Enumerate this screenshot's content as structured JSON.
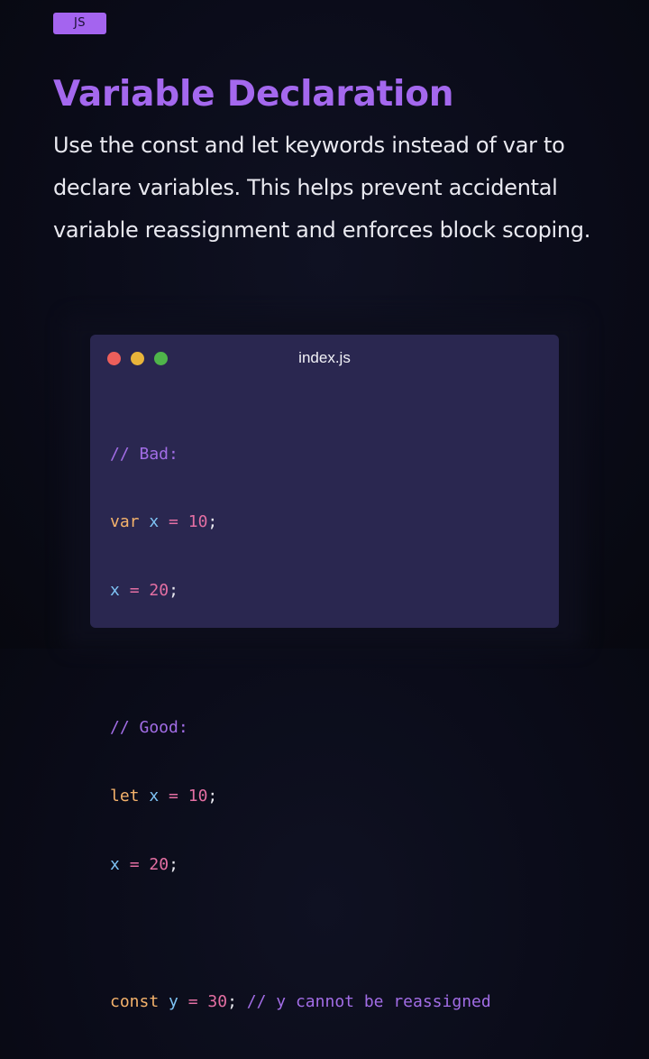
{
  "badge": "JS",
  "title": "Variable Declaration",
  "description": "Use the const and let keywords instead of var to declare variables. This helps prevent accidental variable reassignment and enforces block scoping.",
  "code_window": {
    "filename": "index.js",
    "window_buttons": [
      "red",
      "yellow",
      "green"
    ],
    "lines": {
      "l1": {
        "comment": "// Bad:"
      },
      "l2": {
        "keyword": "var",
        "ident": "x",
        "op": "=",
        "num": "10",
        "punct": ";"
      },
      "l3": {
        "ident": "x",
        "op": "=",
        "num": "20",
        "punct": ";"
      },
      "l5": {
        "comment": "// Good:"
      },
      "l6": {
        "keyword": "let",
        "ident": "x",
        "op": "=",
        "num": "10",
        "punct": ";"
      },
      "l7": {
        "ident": "x",
        "op": "=",
        "num": "20",
        "punct": ";"
      },
      "l9": {
        "keyword": "const",
        "ident": "y",
        "op": "=",
        "num": "30",
        "punct": ";",
        "comment": "// y cannot be reassigned"
      }
    }
  },
  "colors": {
    "accent": "#a468ee",
    "background": "#0a0b18",
    "code_bg": "#2a2750",
    "keyword": "#f4b26b",
    "identifier": "#7ec3f4",
    "number": "#e46fa3",
    "comment": "#a26de6"
  }
}
